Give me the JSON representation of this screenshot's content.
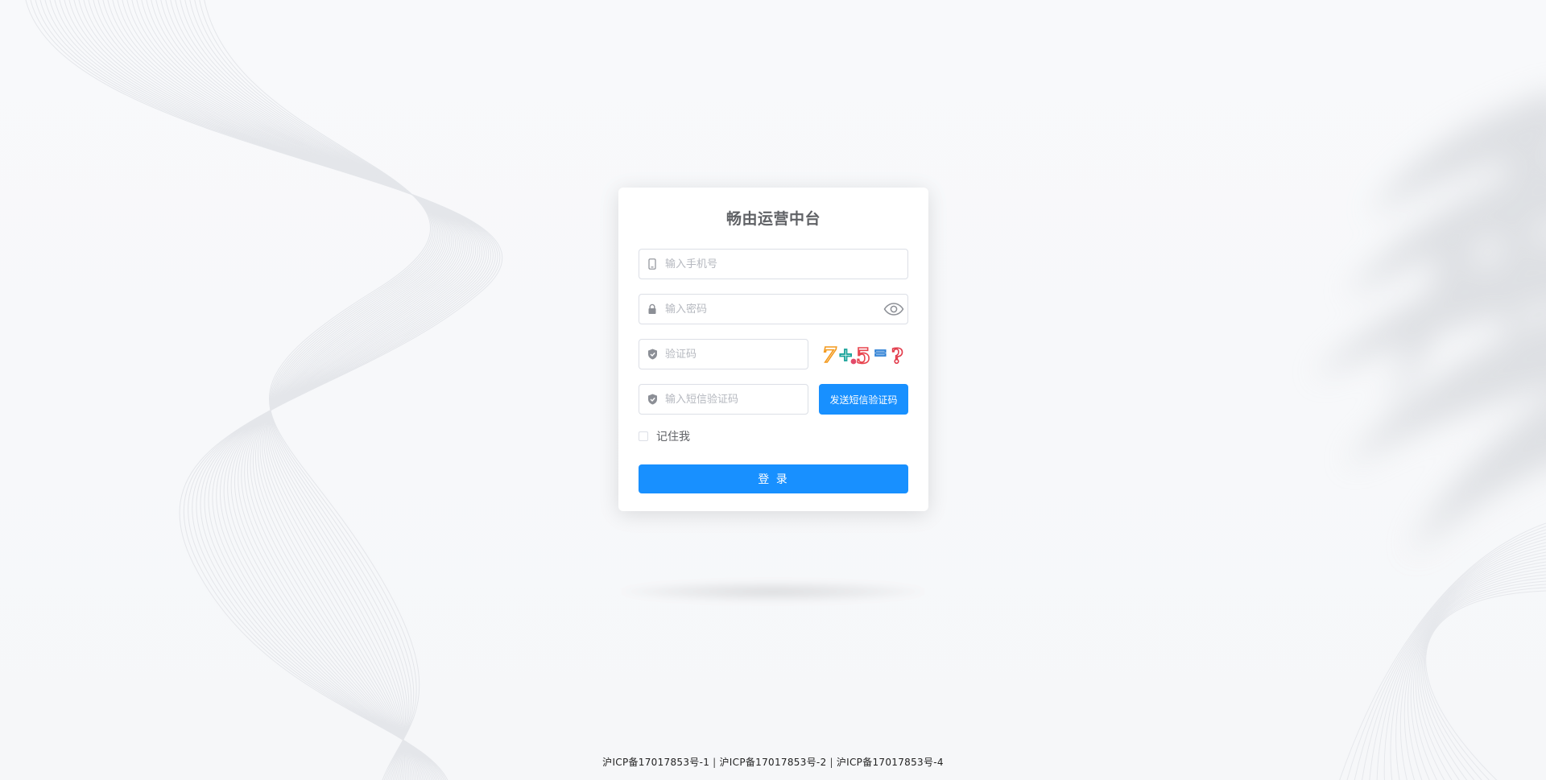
{
  "app": {
    "title": "畅由运营中台"
  },
  "form": {
    "phone_placeholder": "输入手机号",
    "password_placeholder": "输入密码",
    "captcha_placeholder": "验证码",
    "captcha_image_text": "7+5=?",
    "sms_placeholder": "输入短信验证码",
    "sms_button_label": "发送短信验证码",
    "remember_label": "记住我",
    "remember_checked": false,
    "login_label": "登 录"
  },
  "footer": {
    "links": [
      "沪ICP备17017853号-1",
      "沪ICP备17017853号-2",
      "沪ICP备17017853号-4"
    ],
    "separator": "|"
  },
  "colors": {
    "primary": "#1890ff",
    "card_background": "#ffffff",
    "page_background": "#f7f8fa",
    "title": "#606266",
    "placeholder": "#b5b8bf",
    "icon": "#8c8f96"
  },
  "icons": {
    "phone": "mobile-phone-icon",
    "password": "lock-icon",
    "password_toggle": "eye-icon",
    "captcha": "shield-check-icon",
    "sms": "shield-check-icon"
  }
}
